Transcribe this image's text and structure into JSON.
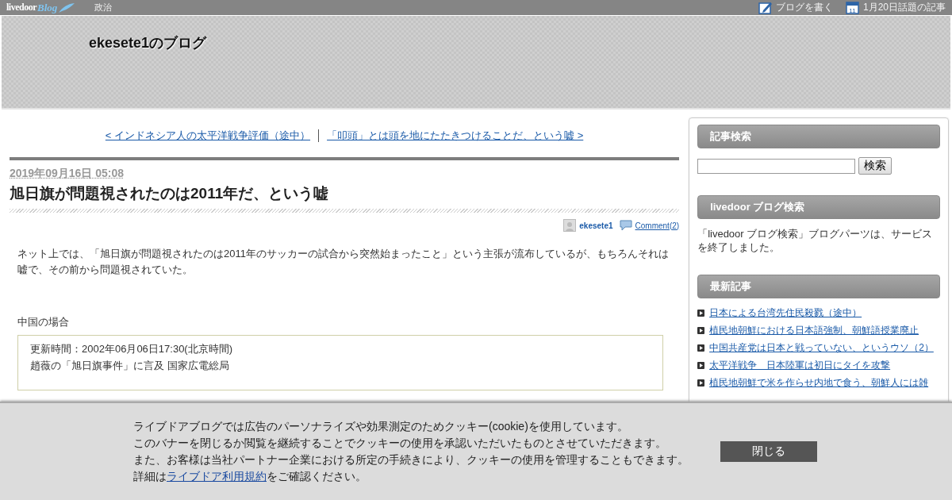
{
  "top_bar": {
    "logo": {
      "word": "livedoor",
      "script": "Blog"
    },
    "category": "政治",
    "links": [
      {
        "kind": "write",
        "label": "ブログを書く"
      },
      {
        "kind": "calendar",
        "label": "1月20日話題の記事",
        "icon_text": "11"
      }
    ]
  },
  "header": {
    "blog_title": "ekesete1のブログ"
  },
  "post_nav": {
    "prev": "< インドネシア人の太平洋戦争評価（途中）",
    "next": "「叩頭」とは頭を地にたたきつけることだ、という嘘 >"
  },
  "article": {
    "date": "2019年09月16日 05:08",
    "title": "旭日旗が問題視されたのは2011年だ、という嘘",
    "author": "ekesete1",
    "comments": "Comment(2)",
    "paragraphs": [
      "ネット上では、「旭日旗が問題視されたのは2011年のサッカーの試合から突然始まったこと」という主張が流布しているが、もちろんそれは嘘で、その前から問題視されていた。",
      "中国の場合"
    ],
    "quote": [
      "更新時間：2002年06月06日17:30(北京時間)",
      "趙薇の「旭日旗事件」に言及 国家広電総局"
    ]
  },
  "sidebar": {
    "widgets": [
      {
        "kind": "search",
        "title": "記事検索",
        "button": "検索"
      },
      {
        "kind": "text",
        "title": "livedoor ブログ検索",
        "text": "「livedoor ブログ検索」ブログパーツは、サービスを終了しました。"
      },
      {
        "kind": "list",
        "title": "最新記事",
        "items": [
          "日本による台湾先住民殺戮（途中）",
          "植民地朝鮮における日本語強制、朝鮮語授業廃止",
          "中国共産党は日本と戦っていない、というウソ（2）",
          "太平洋戦争　日本陸軍は初日にタイを攻撃",
          "植民地朝鮮で米を作らせ内地で食う、朝鮮人には雑"
        ]
      }
    ]
  },
  "cookie_banner": {
    "lines": [
      "ライブドアブログでは広告のパーソナライズや効果測定のためクッキー(cookie)を使用しています。",
      "このバナーを閉じるか閲覧を継続することでクッキーの使用を承認いただいたものとさせていただきます。",
      "また、お客様は当社パートナー企業における所定の手続きにより、クッキーの使用を管理することもできます。"
    ],
    "last_line": {
      "before": "詳細は",
      "link": "ライブドア利用規約",
      "after": "をご確認ください。"
    },
    "close_button": "閉じる"
  }
}
